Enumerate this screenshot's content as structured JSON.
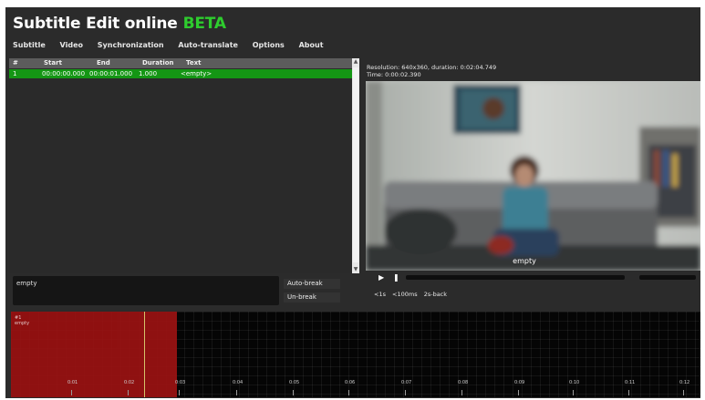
{
  "app": {
    "title": "Subtitle Edit online",
    "badge": "BETA",
    "accent_color": "#2ecc2e",
    "selected_row_color": "#149614",
    "subtitle_region_color": "#9b1212"
  },
  "menu": {
    "items": [
      "Subtitle",
      "Video",
      "Synchronization",
      "Auto-translate",
      "Options",
      "About"
    ]
  },
  "grid": {
    "headers": {
      "num": "#",
      "start": "Start",
      "end": "End",
      "duration": "Duration",
      "text": "Text"
    },
    "rows": [
      {
        "num": "1",
        "start": "00:00:00.000",
        "end": "00:00:01.000",
        "duration": "1.000",
        "text": "<empty>"
      }
    ]
  },
  "editor": {
    "value": "empty",
    "auto_break_label": "Auto-break",
    "unbreak_label": "Un-break"
  },
  "video": {
    "resolution_line": "Resolution: 640x360, duration: 0:02:04.749",
    "time_line": "Time: 0:00:02.390",
    "caption": "empty",
    "play_icon": "play-icon",
    "pause_icon": "pause-icon"
  },
  "seek": {
    "back1s": "<1s",
    "plus100ms": "<100ms",
    "back2s": "2s-back"
  },
  "waveform": {
    "region_label_line1": "#1",
    "region_label_line2": "empty",
    "ticks": [
      "0:01",
      "0:02",
      "0:03",
      "0:04",
      "0:05",
      "0:06",
      "0:07",
      "0:08",
      "0:09",
      "0:10",
      "0:11",
      "0:12"
    ]
  }
}
